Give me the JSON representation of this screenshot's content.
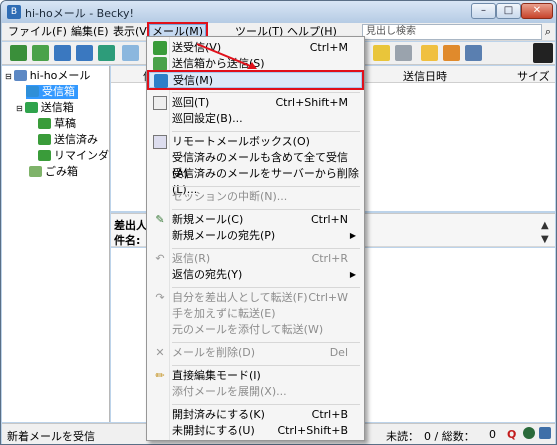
{
  "window": {
    "title": "hi-hoメール - Becky!"
  },
  "menubar": {
    "items": [
      {
        "label": "ファイル(F)"
      },
      {
        "label": "編集(E)"
      },
      {
        "label": "表示(V)"
      },
      {
        "label": "メール(M)"
      },
      {
        "label": "ツール(T)"
      },
      {
        "label": "ヘルプ(H)"
      }
    ],
    "search_placeholder": "見出し検索"
  },
  "tree": {
    "items": [
      {
        "label": "hi-hoメール"
      },
      {
        "label": "受信箱"
      },
      {
        "label": "送信箱"
      },
      {
        "label": "草稿"
      },
      {
        "label": "送信済み"
      },
      {
        "label": "リマインダ"
      },
      {
        "label": "ごみ箱"
      }
    ]
  },
  "list": {
    "columns": [
      {
        "label": "件"
      },
      {
        "label": "送信日時"
      },
      {
        "label": "サイズ"
      }
    ]
  },
  "preview": {
    "from_label": "差出人:",
    "subject_label": "件名:"
  },
  "status": {
    "left": "新着メールを受信",
    "unread": "未読：",
    "counts": "0 / 総数：",
    "total": "0"
  },
  "dropdown": {
    "items": [
      {
        "label": "送受信(V)",
        "shortcut": "Ctrl+M",
        "icon": "send-receive-icon"
      },
      {
        "label": "送信箱から送信(S)",
        "shortcut": "",
        "icon": "send-outbox-icon"
      },
      {
        "label": "受信(M)",
        "shortcut": "",
        "icon": "receive-icon"
      },
      {
        "label": "巡回(T)",
        "shortcut": "Ctrl+Shift+M",
        "icon": "patrol-icon"
      },
      {
        "label": "巡回設定(B)...",
        "shortcut": ""
      },
      {
        "label": "リモートメールボックス(O)",
        "shortcut": "",
        "icon": "remote-mailbox-icon"
      },
      {
        "label": "受信済みのメールも含めて全て受信(A)",
        "shortcut": ""
      },
      {
        "label": "受信済みのメールをサーバーから削除(L)...",
        "shortcut": ""
      },
      {
        "label": "セッションの中断(N)...",
        "shortcut": ""
      },
      {
        "label": "新規メール(C)",
        "shortcut": "Ctrl+N",
        "icon": "new-mail-icon"
      },
      {
        "label": "新規メールの宛先(P)",
        "shortcut": ""
      },
      {
        "label": "返信(R)",
        "shortcut": "Ctrl+R",
        "icon": "reply-icon"
      },
      {
        "label": "返信の宛先(Y)",
        "shortcut": ""
      },
      {
        "label": "自分を差出人として転送(F)",
        "shortcut": "Ctrl+W",
        "icon": "forward-icon"
      },
      {
        "label": "手を加えずに転送(E)",
        "shortcut": ""
      },
      {
        "label": "元のメールを添付して転送(W)",
        "shortcut": ""
      },
      {
        "label": "メールを削除(D)",
        "shortcut": "Del",
        "icon": "delete-icon"
      },
      {
        "label": "直接編集モード(I)",
        "shortcut": "",
        "icon": "pencil-icon"
      },
      {
        "label": "添付メールを展開(X)...",
        "shortcut": ""
      },
      {
        "label": "開封済みにする(K)",
        "shortcut": "Ctrl+B"
      },
      {
        "label": "未開封にする(U)",
        "shortcut": "Ctrl+Shift+B"
      }
    ]
  },
  "colors": {
    "highlight_outline": "#e0101a",
    "selection": "#3399ff"
  }
}
